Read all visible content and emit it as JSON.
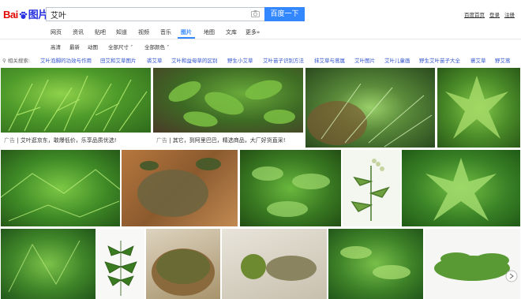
{
  "header": {
    "logo_a": "Bai",
    "logo_b": "图片",
    "query": "艾叶",
    "search_button": "百度一下",
    "links": [
      "百度首页",
      "登录",
      "注册"
    ]
  },
  "nav": {
    "items": [
      "网页",
      "资讯",
      "贴吧",
      "知道",
      "视频",
      "音乐",
      "图片",
      "地图",
      "文库",
      "更多»"
    ],
    "active": "图片"
  },
  "filters": [
    "高清",
    "最新",
    "动图",
    "全部尺寸 ˅",
    "全部颜色 ˅"
  ],
  "related": {
    "label": "相关搜索:",
    "items": [
      "艾叶泡脚的功效与作用",
      "田艾和艾草图片",
      "裘艾草",
      "艾叶和益母草的区别",
      "野生小艾草",
      "艾叶苗子识别方法",
      "抹艾草与蒿属",
      "艾叶图片",
      "艾叶儿童画",
      "野生艾叶苗子大全",
      "蓑艾草",
      "野艾蒿"
    ]
  },
  "ads": [
    {
      "tag": "广告",
      "text": "艾叶逛京东，敢爆低价，乐享品质优选!"
    },
    {
      "tag": "广告",
      "text": "其它，到阿里巴巴，精选商品，大厂好货直采!"
    }
  ],
  "colors": {
    "accent": "#3388ff",
    "link": "#3355cc",
    "logo_red": "#e10602",
    "logo_blue": "#2932e1"
  }
}
